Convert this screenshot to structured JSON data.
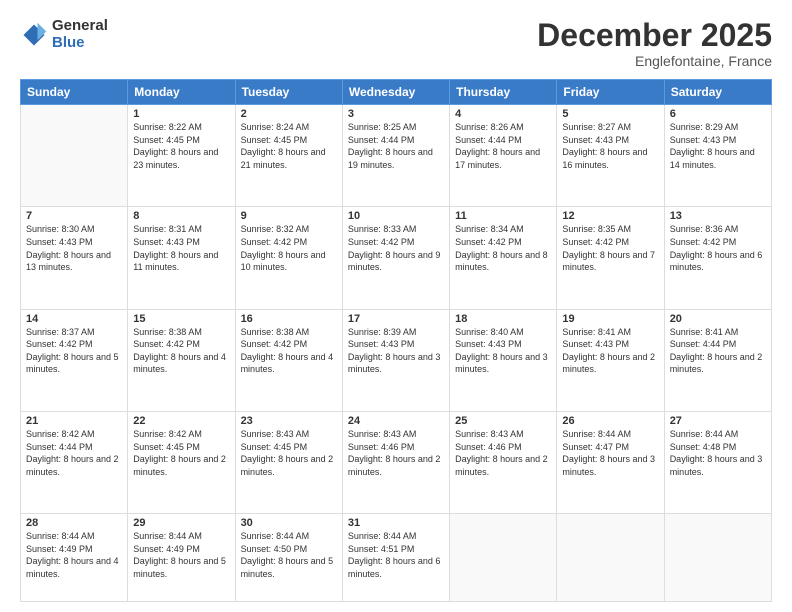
{
  "logo": {
    "general": "General",
    "blue": "Blue"
  },
  "header": {
    "month": "December 2025",
    "location": "Englefontaine, France"
  },
  "weekdays": [
    "Sunday",
    "Monday",
    "Tuesday",
    "Wednesday",
    "Thursday",
    "Friday",
    "Saturday"
  ],
  "weeks": [
    [
      {
        "day": "",
        "sunrise": "",
        "sunset": "",
        "daylight": ""
      },
      {
        "day": "1",
        "sunrise": "Sunrise: 8:22 AM",
        "sunset": "Sunset: 4:45 PM",
        "daylight": "Daylight: 8 hours and 23 minutes."
      },
      {
        "day": "2",
        "sunrise": "Sunrise: 8:24 AM",
        "sunset": "Sunset: 4:45 PM",
        "daylight": "Daylight: 8 hours and 21 minutes."
      },
      {
        "day": "3",
        "sunrise": "Sunrise: 8:25 AM",
        "sunset": "Sunset: 4:44 PM",
        "daylight": "Daylight: 8 hours and 19 minutes."
      },
      {
        "day": "4",
        "sunrise": "Sunrise: 8:26 AM",
        "sunset": "Sunset: 4:44 PM",
        "daylight": "Daylight: 8 hours and 17 minutes."
      },
      {
        "day": "5",
        "sunrise": "Sunrise: 8:27 AM",
        "sunset": "Sunset: 4:43 PM",
        "daylight": "Daylight: 8 hours and 16 minutes."
      },
      {
        "day": "6",
        "sunrise": "Sunrise: 8:29 AM",
        "sunset": "Sunset: 4:43 PM",
        "daylight": "Daylight: 8 hours and 14 minutes."
      }
    ],
    [
      {
        "day": "7",
        "sunrise": "Sunrise: 8:30 AM",
        "sunset": "Sunset: 4:43 PM",
        "daylight": "Daylight: 8 hours and 13 minutes."
      },
      {
        "day": "8",
        "sunrise": "Sunrise: 8:31 AM",
        "sunset": "Sunset: 4:43 PM",
        "daylight": "Daylight: 8 hours and 11 minutes."
      },
      {
        "day": "9",
        "sunrise": "Sunrise: 8:32 AM",
        "sunset": "Sunset: 4:42 PM",
        "daylight": "Daylight: 8 hours and 10 minutes."
      },
      {
        "day": "10",
        "sunrise": "Sunrise: 8:33 AM",
        "sunset": "Sunset: 4:42 PM",
        "daylight": "Daylight: 8 hours and 9 minutes."
      },
      {
        "day": "11",
        "sunrise": "Sunrise: 8:34 AM",
        "sunset": "Sunset: 4:42 PM",
        "daylight": "Daylight: 8 hours and 8 minutes."
      },
      {
        "day": "12",
        "sunrise": "Sunrise: 8:35 AM",
        "sunset": "Sunset: 4:42 PM",
        "daylight": "Daylight: 8 hours and 7 minutes."
      },
      {
        "day": "13",
        "sunrise": "Sunrise: 8:36 AM",
        "sunset": "Sunset: 4:42 PM",
        "daylight": "Daylight: 8 hours and 6 minutes."
      }
    ],
    [
      {
        "day": "14",
        "sunrise": "Sunrise: 8:37 AM",
        "sunset": "Sunset: 4:42 PM",
        "daylight": "Daylight: 8 hours and 5 minutes."
      },
      {
        "day": "15",
        "sunrise": "Sunrise: 8:38 AM",
        "sunset": "Sunset: 4:42 PM",
        "daylight": "Daylight: 8 hours and 4 minutes."
      },
      {
        "day": "16",
        "sunrise": "Sunrise: 8:38 AM",
        "sunset": "Sunset: 4:42 PM",
        "daylight": "Daylight: 8 hours and 4 minutes."
      },
      {
        "day": "17",
        "sunrise": "Sunrise: 8:39 AM",
        "sunset": "Sunset: 4:43 PM",
        "daylight": "Daylight: 8 hours and 3 minutes."
      },
      {
        "day": "18",
        "sunrise": "Sunrise: 8:40 AM",
        "sunset": "Sunset: 4:43 PM",
        "daylight": "Daylight: 8 hours and 3 minutes."
      },
      {
        "day": "19",
        "sunrise": "Sunrise: 8:41 AM",
        "sunset": "Sunset: 4:43 PM",
        "daylight": "Daylight: 8 hours and 2 minutes."
      },
      {
        "day": "20",
        "sunrise": "Sunrise: 8:41 AM",
        "sunset": "Sunset: 4:44 PM",
        "daylight": "Daylight: 8 hours and 2 minutes."
      }
    ],
    [
      {
        "day": "21",
        "sunrise": "Sunrise: 8:42 AM",
        "sunset": "Sunset: 4:44 PM",
        "daylight": "Daylight: 8 hours and 2 minutes."
      },
      {
        "day": "22",
        "sunrise": "Sunrise: 8:42 AM",
        "sunset": "Sunset: 4:45 PM",
        "daylight": "Daylight: 8 hours and 2 minutes."
      },
      {
        "day": "23",
        "sunrise": "Sunrise: 8:43 AM",
        "sunset": "Sunset: 4:45 PM",
        "daylight": "Daylight: 8 hours and 2 minutes."
      },
      {
        "day": "24",
        "sunrise": "Sunrise: 8:43 AM",
        "sunset": "Sunset: 4:46 PM",
        "daylight": "Daylight: 8 hours and 2 minutes."
      },
      {
        "day": "25",
        "sunrise": "Sunrise: 8:43 AM",
        "sunset": "Sunset: 4:46 PM",
        "daylight": "Daylight: 8 hours and 2 minutes."
      },
      {
        "day": "26",
        "sunrise": "Sunrise: 8:44 AM",
        "sunset": "Sunset: 4:47 PM",
        "daylight": "Daylight: 8 hours and 3 minutes."
      },
      {
        "day": "27",
        "sunrise": "Sunrise: 8:44 AM",
        "sunset": "Sunset: 4:48 PM",
        "daylight": "Daylight: 8 hours and 3 minutes."
      }
    ],
    [
      {
        "day": "28",
        "sunrise": "Sunrise: 8:44 AM",
        "sunset": "Sunset: 4:49 PM",
        "daylight": "Daylight: 8 hours and 4 minutes."
      },
      {
        "day": "29",
        "sunrise": "Sunrise: 8:44 AM",
        "sunset": "Sunset: 4:49 PM",
        "daylight": "Daylight: 8 hours and 5 minutes."
      },
      {
        "day": "30",
        "sunrise": "Sunrise: 8:44 AM",
        "sunset": "Sunset: 4:50 PM",
        "daylight": "Daylight: 8 hours and 5 minutes."
      },
      {
        "day": "31",
        "sunrise": "Sunrise: 8:44 AM",
        "sunset": "Sunset: 4:51 PM",
        "daylight": "Daylight: 8 hours and 6 minutes."
      },
      {
        "day": "",
        "sunrise": "",
        "sunset": "",
        "daylight": ""
      },
      {
        "day": "",
        "sunrise": "",
        "sunset": "",
        "daylight": ""
      },
      {
        "day": "",
        "sunrise": "",
        "sunset": "",
        "daylight": ""
      }
    ]
  ]
}
